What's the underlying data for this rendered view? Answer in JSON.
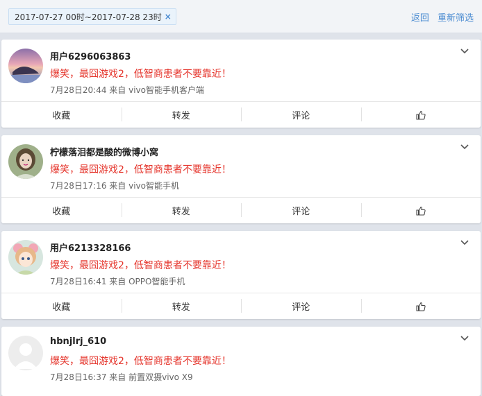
{
  "filter": {
    "tag_text": "2017-07-27 00时~2017-07-28 23时",
    "tag_close": "×",
    "back_label": "返回",
    "refilter_label": "重新筛选"
  },
  "posts": [
    {
      "username": "用户6296063863",
      "content": "爆笑，最囧游戏2，低智商患者不要靠近！",
      "meta": "7月28日20:44 来自 vivo智能手机客户端",
      "avatar": "sunset-boat-avatar"
    },
    {
      "username": "柠檬落泪都是酸的微博小窝",
      "content": "爆笑，最囧游戏2，低智商患者不要靠近！",
      "meta": "7月28日17:16 来自 vivo智能手机",
      "avatar": "girl-photo-avatar"
    },
    {
      "username": "用户6213328166",
      "content": "爆笑，最囧游戏2，低智商患者不要靠近！",
      "meta": "7月28日16:41 来自 OPPO智能手机",
      "avatar": "anime-girl-avatar"
    },
    {
      "username": "hbnjlrj_610",
      "content": "爆笑，最囧游戏2，低智商患者不要靠近！",
      "meta": "7月28日16:37 来自 前置双摄vivo X9",
      "avatar": "default-avatar"
    }
  ],
  "actions": {
    "collect": "收藏",
    "repost": "转发",
    "comment": "评论",
    "like_icon": "thumbs-up-icon"
  },
  "colors": {
    "accent": "#4a8bd1",
    "content_red": "#e5352c",
    "background": "#dfe3ea"
  }
}
